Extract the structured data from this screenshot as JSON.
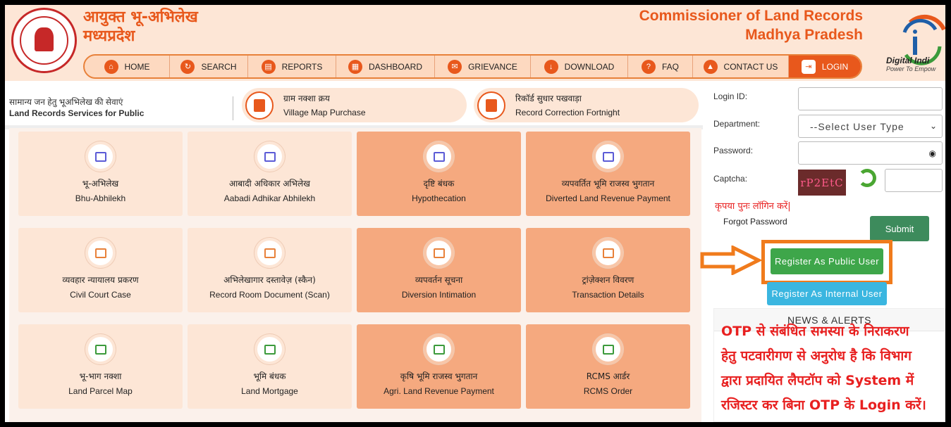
{
  "header": {
    "title_hi_line1": "आयुक्त भू-अभिलेख",
    "title_hi_line2": "मध्यप्रदेश",
    "title_en_line1": "Commissioner of Land Records",
    "title_en_line2": "Madhya Pradesh",
    "logo_text": "Digital Indi",
    "logo_tagline": "Power To Empow"
  },
  "nav": [
    {
      "label": "HOME",
      "icon": "home-icon",
      "glyph": "⌂"
    },
    {
      "label": "SEARCH",
      "icon": "search-icon",
      "glyph": "↻"
    },
    {
      "label": "REPORTS",
      "icon": "report-icon",
      "glyph": "▤"
    },
    {
      "label": "DASHBOARD",
      "icon": "dashboard-icon",
      "glyph": "▦"
    },
    {
      "label": "GRIEVANCE",
      "icon": "grievance-icon",
      "glyph": "✉"
    },
    {
      "label": "DOWNLOAD",
      "icon": "download-icon",
      "glyph": "↓"
    },
    {
      "label": "FAQ",
      "icon": "faq-icon",
      "glyph": "?"
    },
    {
      "label": "CONTACT US",
      "icon": "contact-icon",
      "glyph": "▲"
    },
    {
      "label": "LOGIN",
      "icon": "login-icon",
      "glyph": "⇥"
    }
  ],
  "services_header": {
    "hi": "सामान्य जन हेतु भूअभिलेख की सेवाएं",
    "en": "Land Records Services for Public"
  },
  "pills": [
    {
      "hi": "ग्राम नक्शा क्रय",
      "en": "Village Map Purchase"
    },
    {
      "hi": "रिकॉर्ड सुधार पखवाड़ा",
      "en": "Record Correction Fortnight"
    }
  ],
  "cards": [
    {
      "hi": "भू-अभिलेख",
      "en": "Bhu-Abhilekh"
    },
    {
      "hi": "आबादी अधिकार अभिलेख",
      "en": "Aabadi Adhikar Abhilekh"
    },
    {
      "hi": "दृष्टि बंधक",
      "en": "Hypothecation"
    },
    {
      "hi": "व्यपवर्तित भूमि राजस्व भुगतान",
      "en": "Diverted Land Revenue Payment"
    },
    {
      "hi": "व्यवहार न्यायालय प्रकरण",
      "en": "Civil Court Case"
    },
    {
      "hi": "अभिलेखागार दस्तावेज़ (स्कैन)",
      "en": "Record Room Document (Scan)"
    },
    {
      "hi": "व्यपवर्तन सूचना",
      "en": "Diversion Intimation"
    },
    {
      "hi": "ट्रांज़ेक्शन विवरण",
      "en": "Transaction Details"
    },
    {
      "hi": "भू-भाग नक्शा",
      "en": "Land Parcel Map"
    },
    {
      "hi": "भूमि बंधक",
      "en": "Land Mortgage"
    },
    {
      "hi": "कृषि भूमि राजस्व भुगतान",
      "en": "Agri. Land Revenue Payment"
    },
    {
      "hi": "RCMS आर्डर",
      "en": "RCMS Order"
    }
  ],
  "login": {
    "login_id_label": "Login ID:",
    "login_id_value": "",
    "department_label": "Department:",
    "department_value": "--Select User Type",
    "password_label": "Password:",
    "password_value": "",
    "captcha_label": "Captcha:",
    "captcha_text": "rP2EtC",
    "captcha_value": "",
    "retry_message": "कृपया पुनः लॉगिन करें|",
    "forgot_password": "Forgot Password",
    "submit": "Submit",
    "register_public": "Register As Public User",
    "register_internal": "Register As Internal User"
  },
  "news": {
    "title": "NEWS & ALERTS",
    "lines": [
      "OTP से संबंधित समस्या के निराकरण",
      "हेतु पटवारीगण से अनुरोध है कि विभाग",
      "द्वारा प्रदायित लैपटॉप को System में",
      "रजिस्टर कर बिना OTP के Login करें।"
    ]
  },
  "colors": {
    "accent": "#e8581c",
    "header_bg": "#fde6d6",
    "card_dark": "#f5a97f",
    "alert_red": "#e82020",
    "highlight_orange": "#f07b1c"
  }
}
